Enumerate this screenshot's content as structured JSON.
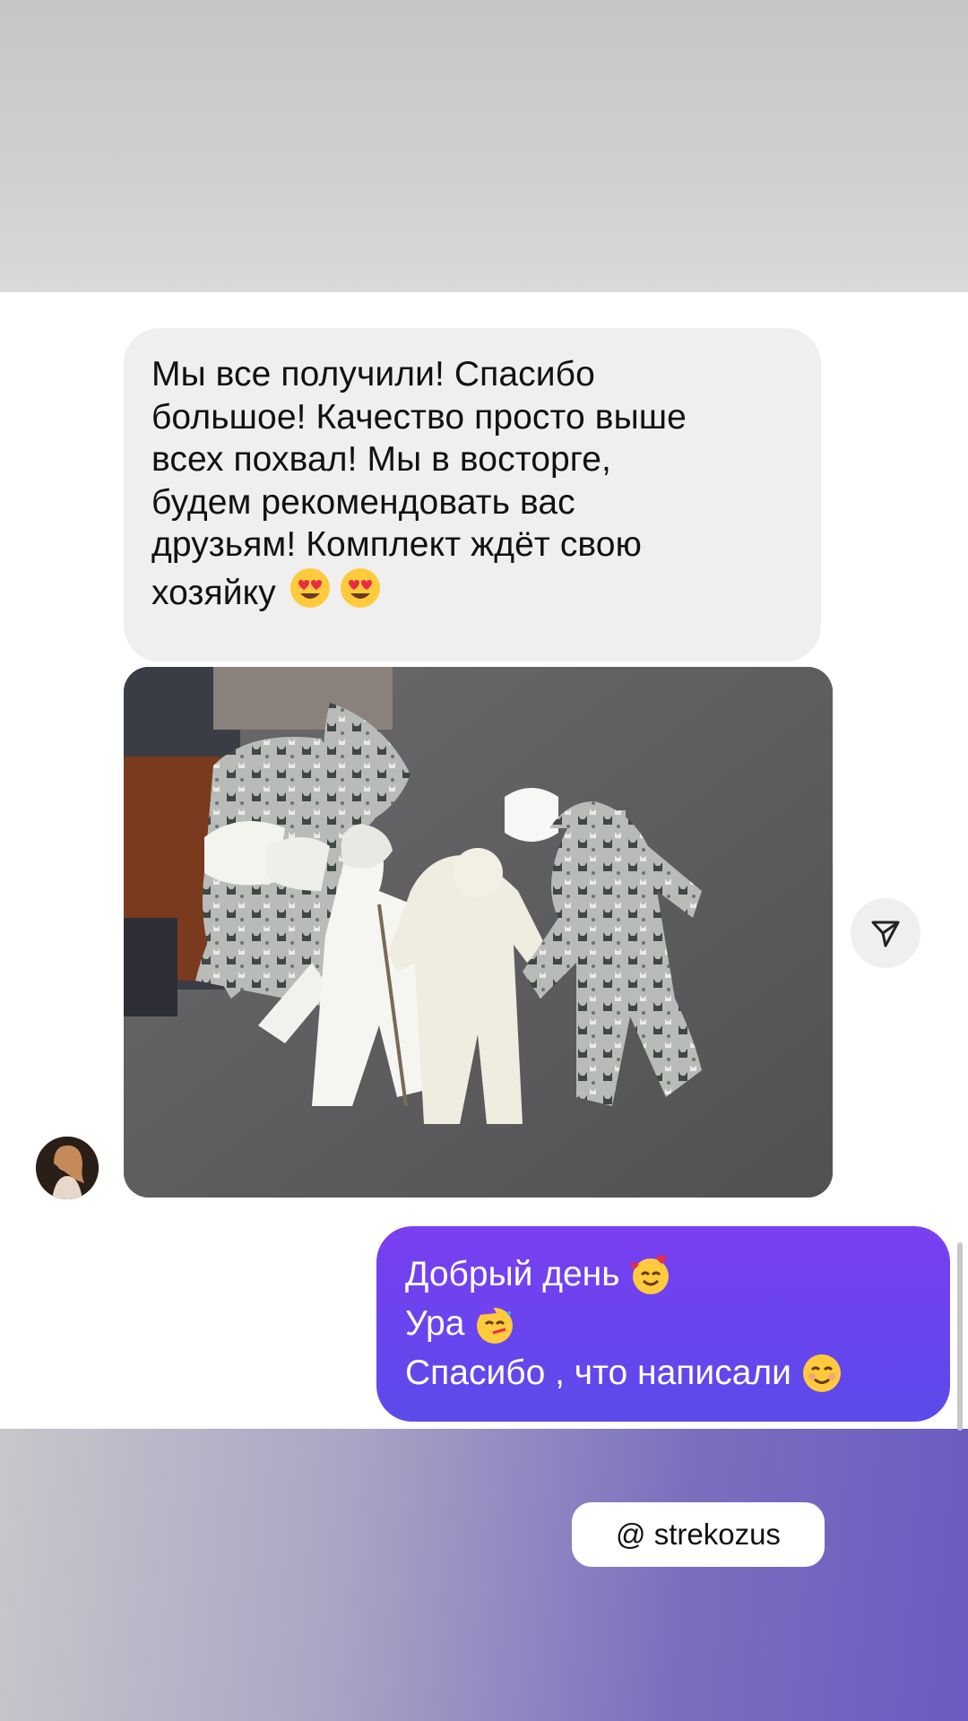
{
  "story": {
    "incoming_message": {
      "text": "Мы все получили! Спасибо\nбольшое! Качество просто выше\nвсех похвал! Мы в восторге,\nбудем рекомендовать вас\nдрузьям! Комплект ждёт свою\nхозяйку"
    },
    "outgoing_message": {
      "lines": [
        "Добрый день",
        "Ура",
        "Спасибо , что написали"
      ]
    },
    "mention": {
      "label": "@ strekozus"
    }
  },
  "colors": {
    "incoming_bubble": "#efefef",
    "outgoing_bubble": "#6a44ee",
    "background_gray": "#c9c9cb",
    "accent_purple": "#6a5cc0"
  },
  "icons": [
    "smiling-face-with-heart-eyes-icon",
    "smiling-face-with-hearts-icon",
    "partying-face-icon",
    "smiling-face-icon",
    "send-icon",
    "at-sign-icon"
  ]
}
